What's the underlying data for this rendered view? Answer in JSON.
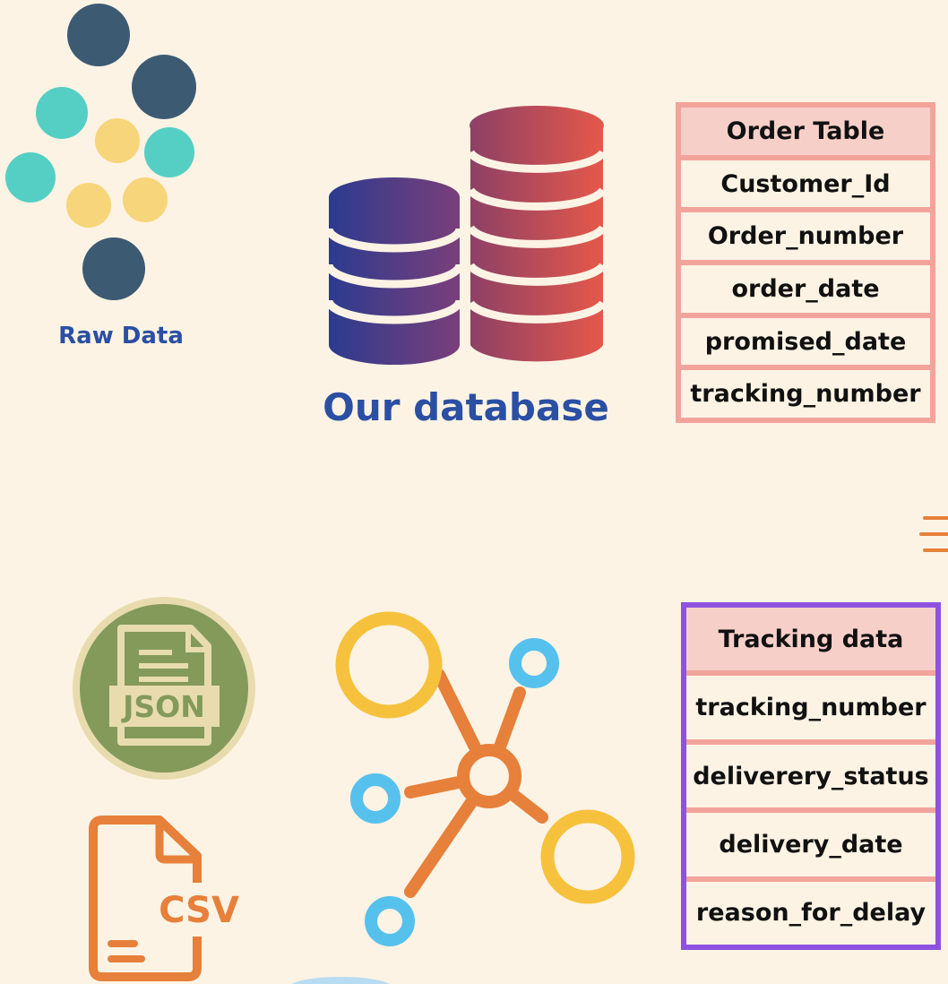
{
  "raw_data": {
    "label": "Raw Data"
  },
  "database": {
    "label": "Our database"
  },
  "order_table": {
    "title": "Order Table",
    "fields": [
      "Customer_Id",
      "Order_number",
      "order_date",
      "promised_date",
      "tracking_number"
    ]
  },
  "tracking_table": {
    "title": "Tracking data",
    "fields": [
      "tracking_number",
      "deliverery_status",
      "delivery_date",
      "reason_for_delay"
    ]
  },
  "json_badge": {
    "text": "JSON"
  },
  "csv_file": {
    "text": "CSV"
  },
  "colors": {
    "background": "#fdf3e4",
    "label_blue": "#2a4fa3",
    "dark_dot": "#3d5a73",
    "teal_dot": "#55cfc4",
    "yellow_dot": "#f7d57a",
    "table_border": "#f2a49c",
    "tracking_border": "#8e52e0",
    "orange": "#e6803a",
    "ring_yellow": "#f6c23e",
    "ring_blue": "#56c1ec"
  },
  "icons": [
    "raw-data-dots",
    "database-icon",
    "json-file-icon",
    "csv-file-icon",
    "network-icon"
  ]
}
